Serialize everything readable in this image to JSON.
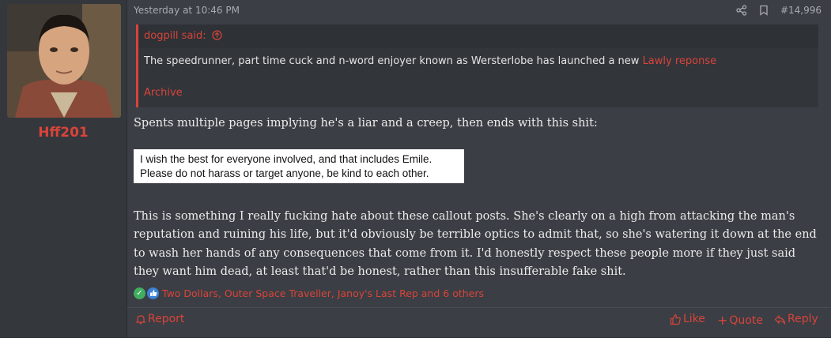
{
  "user": {
    "name": "Hff201"
  },
  "post": {
    "date": "Yesterday at 10:46 PM",
    "number": "#14,996",
    "quote": {
      "author_label": "dogpill said:",
      "body": "The speedrunner, part time cuck and n-word enjoyer known as Wersterlobe has launched a new ",
      "link_text": "Lawly reponse",
      "archive_label": "Archive"
    },
    "paragraph1": "Spents multiple pages implying he's a liar and a creep, then ends with this shit:",
    "image_text": {
      "line1": "I wish the best for everyone involved, and that includes Emile.",
      "line2": "Please do not harass or target anyone, be kind to each other."
    },
    "paragraph2": "This is something I really fucking hate about these callout posts. She's clearly on a high from attacking the man's reputation and ruining his life, but it'd obviously be terrible optics to admit that, so she's watering it down at the end to wash her hands of any consequences that come from it. I'd honestly respect these people more if they just said they want him dead, at least that'd be honest, rather than this insufferable fake shit.",
    "reactions_text": "Two Dollars, Outer Space Traveller, Janoy's Last Rep and 6 others"
  },
  "footer": {
    "report": "Report",
    "like": "Like",
    "quote": "Quote",
    "reply": "Reply"
  },
  "colors": {
    "accent": "#d9443a",
    "background": "#3b3e44",
    "sidebar": "#34373c"
  }
}
